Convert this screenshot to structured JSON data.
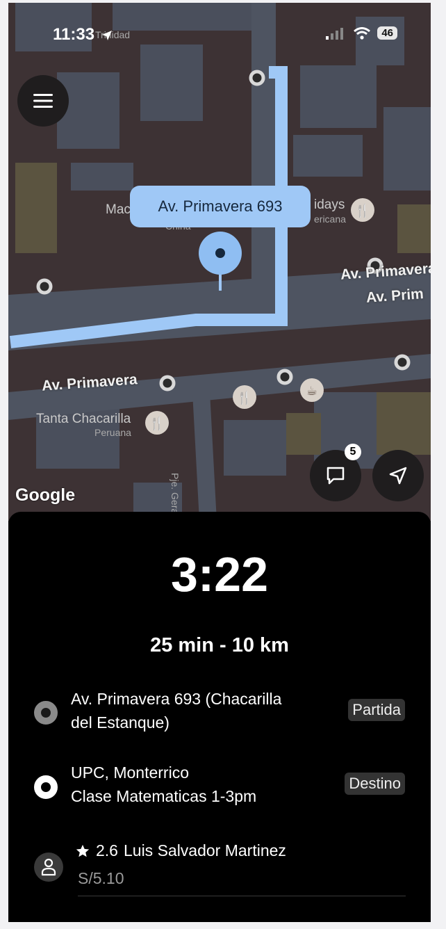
{
  "status_bar": {
    "time": "11:33",
    "battery": "46"
  },
  "map": {
    "pickup_bubble": "Av. Primavera 693",
    "roads": [
      "Av. Primavera",
      "Av. Primavera",
      "Av. Prim",
      "Pje. Geranio"
    ],
    "places": [
      "Tanta Chacarilla",
      "Peruana",
      "Mac",
      "China",
      "idays",
      "ericana",
      "Trinidad"
    ],
    "brand": "Google",
    "chat_badge": "5"
  },
  "trip": {
    "eta": "3:22",
    "summary": "25 min - 10 km",
    "pickup": {
      "line1": "Av. Primavera 693 (Chacarilla",
      "line2": "del Estanque)",
      "tag": "Partida"
    },
    "destination": {
      "line1": "UPC, Monterrico",
      "line2": "Clase Matematicas 1-3pm",
      "tag": "Destino"
    },
    "driver": {
      "rating": "2.6",
      "name": "Luis Salvador Martinez",
      "price": "S/5.10"
    }
  },
  "colors": {
    "route": "#9fc8f6",
    "map_bg": "#3d3234",
    "panel_bg": "#000000"
  }
}
